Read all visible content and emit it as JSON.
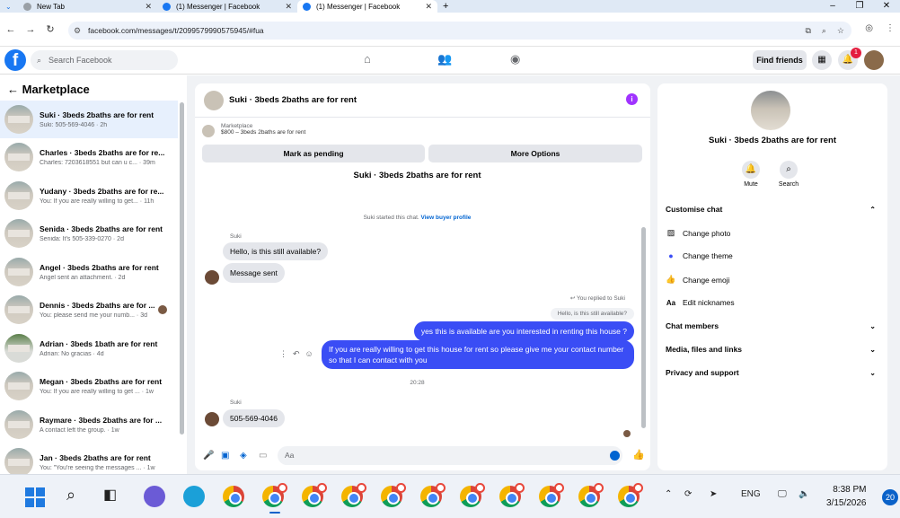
{
  "browser": {
    "tabs": [
      {
        "title": "New Tab",
        "active": false
      },
      {
        "title": "(1) Messenger | Facebook",
        "active": false
      },
      {
        "title": "(1) Messenger | Facebook",
        "active": true
      }
    ],
    "url": "facebook.com/messages/t/2099579990575945/#fua"
  },
  "fb": {
    "search_placeholder": "Search Facebook",
    "find_friends": "Find friends",
    "notification_count": "1"
  },
  "left": {
    "title": "Marketplace",
    "conversations": [
      {
        "name": "Suki · 3beds 2baths are for rent",
        "preview": "Suki: 505-569-4046 · 2h"
      },
      {
        "name": "Charles · 3beds 2baths are for re...",
        "preview": "Charles: 7203618551 but can u c... · 39m"
      },
      {
        "name": "Yudany · 3beds 2baths are for re...",
        "preview": "You: If you are really willing to get... · 11h"
      },
      {
        "name": "Senida · 3beds 2baths are for rent",
        "preview": "Senida: It's 505-339-0270 · 2d"
      },
      {
        "name": "Angel · 3beds 2baths are for rent",
        "preview": "Angel sent an attachment. · 2d"
      },
      {
        "name": "Dennis · 3beds 2baths are for ...",
        "preview": "You: please send me your numb... · 3d"
      },
      {
        "name": "Adrian · 3beds 1bath are for rent",
        "preview": "Adrian: No gracias · 4d"
      },
      {
        "name": "Megan · 3beds 2baths are for rent",
        "preview": "You: If you are really willing to get ... · 1w"
      },
      {
        "name": "Raymare · 3beds 2baths are for ...",
        "preview": "A contact left the group. · 1w"
      },
      {
        "name": "Jan · 3beds 2baths are for rent",
        "preview": "You: \"You're seeing the messages ... · 1w"
      }
    ]
  },
  "chat": {
    "header_name": "Suki · 3beds 2baths are for rent",
    "marketplace_label": "Marketplace",
    "listing": "$800 – 3beds 2baths are for rent",
    "mark_pending": "Mark as pending",
    "more_options": "More Options",
    "title": "Suki · 3beds 2baths are for rent",
    "system_text": "Suki started this chat.",
    "system_link": "View buyer profile",
    "sender1": "Suki",
    "msg1": "Hello, is this still available?",
    "msg2": "Message sent",
    "replied_label": "You replied to Suki",
    "quoted": "Hello, is this still available?",
    "out1": "yes this is available are you interested in renting this house ?",
    "out2": "If you are really willing to get this house for rent so please give me your contact number so that I  can contact with you",
    "time": "20:28",
    "sender2": "Suki",
    "msg3": "505-569-4046",
    "composer_placeholder": "Aa"
  },
  "right": {
    "name": "Suki · 3beds 2baths are for rent",
    "mute": "Mute",
    "search": "Search",
    "customise": "Customise chat",
    "change_photo": "Change photo",
    "change_theme": "Change theme",
    "change_emoji": "Change emoji",
    "edit_nicknames": "Edit nicknames",
    "nick_icon": "Aa",
    "members": "Chat members",
    "media": "Media, files and links",
    "privacy": "Privacy and support"
  },
  "taskbar": {
    "lang": "ENG",
    "time": "8:38 PM",
    "date": "3/15/2026",
    "badge": "20"
  }
}
